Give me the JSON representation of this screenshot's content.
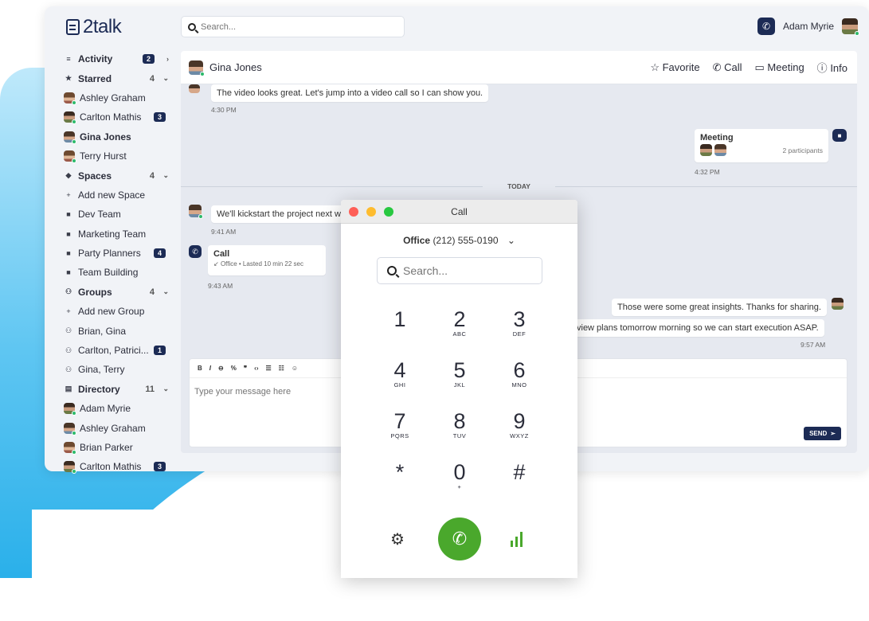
{
  "app": {
    "logo_text": "2talk",
    "search_placeholder": "Search..."
  },
  "user": {
    "name": "Adam Myrie"
  },
  "sidebar": {
    "items": [
      {
        "type": "section",
        "icon": "list-icon",
        "label": "Activity",
        "badge": "2",
        "chev": "›"
      },
      {
        "type": "section",
        "icon": "star-icon",
        "label": "Starred",
        "count": "4",
        "chev": "⌄"
      },
      {
        "type": "contact",
        "label": "Ashley Graham"
      },
      {
        "type": "contact",
        "label": "Carlton Mathis",
        "badge": "3"
      },
      {
        "type": "contact",
        "label": "Gina Jones",
        "bold": true
      },
      {
        "type": "contact",
        "label": "Terry Hurst"
      },
      {
        "type": "section",
        "icon": "leaf-icon",
        "label": "Spaces",
        "count": "4",
        "chev": "⌄"
      },
      {
        "type": "add",
        "label": "Add new Space"
      },
      {
        "type": "space",
        "label": "Dev Team"
      },
      {
        "type": "space",
        "label": "Marketing Team"
      },
      {
        "type": "space",
        "label": "Party Planners",
        "badge": "4"
      },
      {
        "type": "space",
        "label": "Team Building"
      },
      {
        "type": "section",
        "icon": "group-icon",
        "label": "Groups",
        "count": "4",
        "chev": "⌄"
      },
      {
        "type": "add",
        "label": "Add new Group"
      },
      {
        "type": "group",
        "label": "Brian, Gina"
      },
      {
        "type": "group",
        "label": "Carlton, Patrici...",
        "badge": "1"
      },
      {
        "type": "group",
        "label": "Gina, Terry"
      },
      {
        "type": "section",
        "icon": "directory-icon",
        "label": "Directory",
        "count": "11",
        "chev": "⌄"
      },
      {
        "type": "contact",
        "label": "Adam Myrie"
      },
      {
        "type": "contact",
        "label": "Ashley Graham"
      },
      {
        "type": "contact",
        "label": "Brian Parker"
      },
      {
        "type": "contact",
        "label": "Carlton Mathis",
        "badge": "3"
      }
    ]
  },
  "chat": {
    "contact": "Gina Jones",
    "actions": {
      "favorite": "Favorite",
      "call": "Call",
      "meeting": "Meeting",
      "info": "Info"
    },
    "messages": {
      "m1": "The video looks great. Let's jump into a video call so I can show you.",
      "m1_time": "4:30 PM",
      "meeting_title": "Meeting",
      "meeting_participants": "2 participants",
      "meeting_time": "4:32 PM",
      "divider": "TODAY",
      "m2": "We'll kickstart the project next w",
      "m2_time": "9:41 AM",
      "call_title": "Call",
      "call_detail": "Office • Lasted 10 min 22 sec",
      "call_time": "9:43 AM",
      "m3": "Those were some great insights. Thanks for sharing.",
      "m4": "view plans tomorrow morning so we can start execution ASAP.",
      "m4_time": "9:57 AM"
    },
    "composer": {
      "placeholder": "Type your message here",
      "send": "SEND"
    }
  },
  "dialer": {
    "title": "Call",
    "line_name": "Office",
    "line_number": "(212) 555-0190",
    "search_placeholder": "Search...",
    "keys": [
      {
        "d": "1",
        "l": ""
      },
      {
        "d": "2",
        "l": "ABC"
      },
      {
        "d": "3",
        "l": "DEF"
      },
      {
        "d": "4",
        "l": "GHI"
      },
      {
        "d": "5",
        "l": "JKL"
      },
      {
        "d": "6",
        "l": "MNO"
      },
      {
        "d": "7",
        "l": "PQRS"
      },
      {
        "d": "8",
        "l": "TUV"
      },
      {
        "d": "9",
        "l": "WXYZ"
      },
      {
        "d": "*",
        "l": ""
      },
      {
        "d": "0",
        "l": "+"
      },
      {
        "d": "#",
        "l": ""
      }
    ]
  },
  "colors": {
    "navy": "#1c2b55",
    "green": "#4aa82c",
    "blue": "#2ab0ea"
  }
}
